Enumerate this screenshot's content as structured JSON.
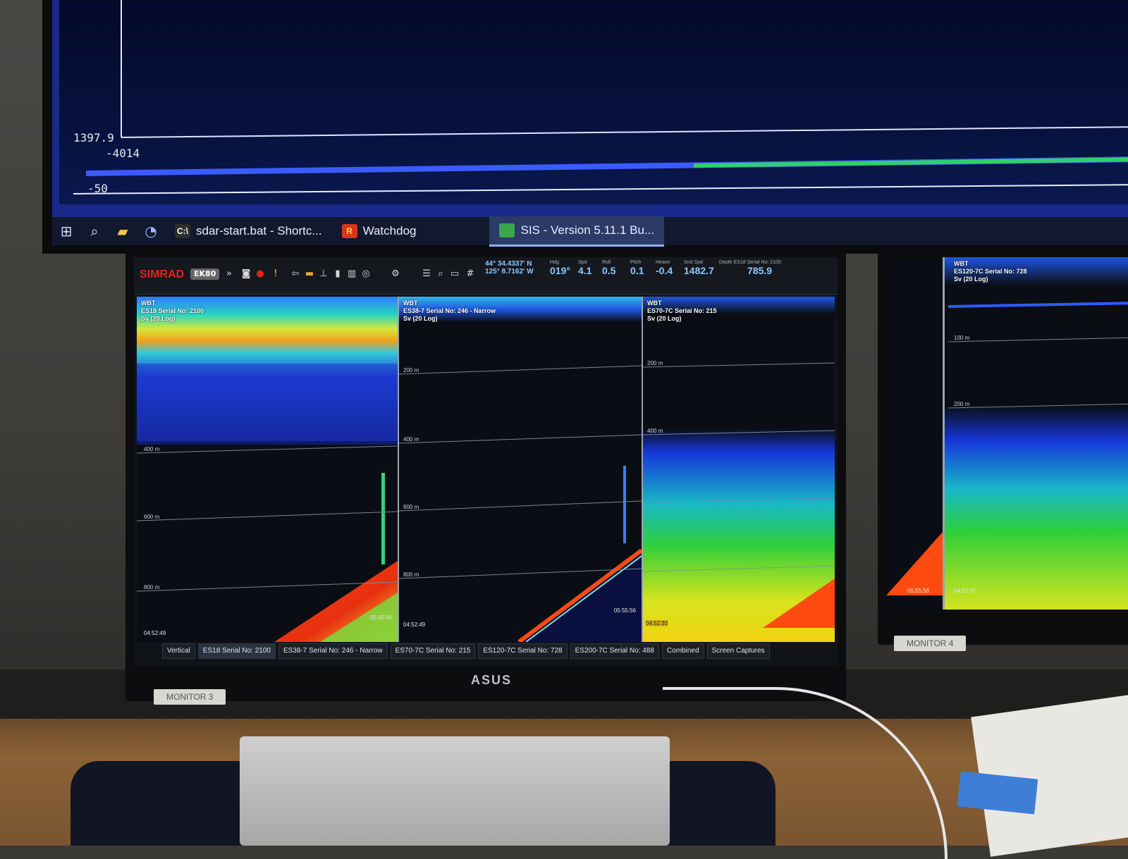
{
  "top_monitor": {
    "plot": {
      "value_1": "1397.9",
      "value_2": "-4014",
      "value_3": "-50"
    },
    "taskbar": {
      "items": [
        {
          "label": "sdar-start.bat - Shortc...",
          "glyph": "C:\\"
        },
        {
          "label": "Watchdog",
          "glyph": "R"
        },
        {
          "label": "SIS - Version 5.11.1 Bu...",
          "glyph": ""
        }
      ],
      "colors": {
        "bar": "#12182e",
        "active": "#2b3a66"
      }
    }
  },
  "ek80": {
    "brand": "SIMRAD",
    "model": "EK80",
    "nav": [
      {
        "label": "",
        "value": "44° 34.4337' N"
      },
      {
        "label": "",
        "value": "125° 8.7162' W"
      },
      {
        "label": "Hdg",
        "value": "019°"
      },
      {
        "label": "Spd",
        "value": "4.1"
      },
      {
        "label": "Roll",
        "value": "0.5"
      },
      {
        "label": "Pitch",
        "value": "0.1"
      },
      {
        "label": "Heave",
        "value": "-0.4"
      },
      {
        "label": "Snd Spd",
        "value": "1482.7"
      },
      {
        "label": "Depth ES18 Serial No: 2100",
        "value": "785.9"
      }
    ],
    "panels": [
      {
        "mode": "WBT",
        "channel": "ES18 Serial No: 2100",
        "var": "Sv (20 Log)",
        "ticks": [
          "400 m",
          "600 m",
          "800 m"
        ],
        "start": "04:52:49",
        "end": "05:55:56"
      },
      {
        "mode": "WBT",
        "channel": "ES38-7 Serial No: 246 - Narrow",
        "var": "Sv (20 Log)",
        "ticks": [
          "200 m",
          "400 m",
          "600 m",
          "800 m"
        ],
        "start": "04:52:49",
        "end": "05:55:56"
      },
      {
        "mode": "WBT",
        "channel": "ES70-7C Serial No: 215",
        "var": "Sv (20 Log)",
        "ticks": [
          "200 m",
          "400 m"
        ],
        "start": "04:52:33",
        "end": ""
      }
    ],
    "tabs": [
      "Vertical",
      "ES18 Serial No: 2100",
      "ES38-7 Serial No: 246 - Narrow",
      "ES70-7C Serial No: 215",
      "ES120-7C Serial No: 728",
      "ES200-7C Serial No: 488",
      "Combined",
      "Screen Captures"
    ],
    "active_tab": "ES18 Serial No: 2100"
  },
  "monitor4_panel": {
    "mode": "WBT",
    "channel": "ES120-7C Serial No: 728",
    "var": "Sv (20 Log)",
    "ticks": [
      "100 m",
      "200 m"
    ],
    "start": "04:52:37",
    "end": "05:55:56"
  },
  "labels": {
    "brand": "ASUS",
    "monitor3": "MONITOR 3",
    "monitor4": "MONITOR 4"
  }
}
